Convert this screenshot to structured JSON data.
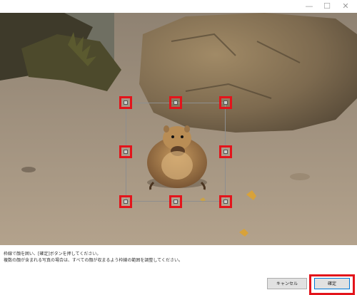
{
  "window": {
    "minimize_glyph": "—",
    "maximize_glyph": "☐",
    "close_glyph": "✕"
  },
  "instructions": {
    "line1": "枠線で顔を囲い、[確定]ボタンを押してください。",
    "line2": "複数の顔が含まれる写真の場合は、すべての顔が収まるよう枠線の範囲を調整してください。"
  },
  "buttons": {
    "cancel": "キャンセル",
    "confirm": "確定"
  },
  "colors": {
    "highlight": "#e3141b",
    "frame": "#8e8e8e"
  }
}
